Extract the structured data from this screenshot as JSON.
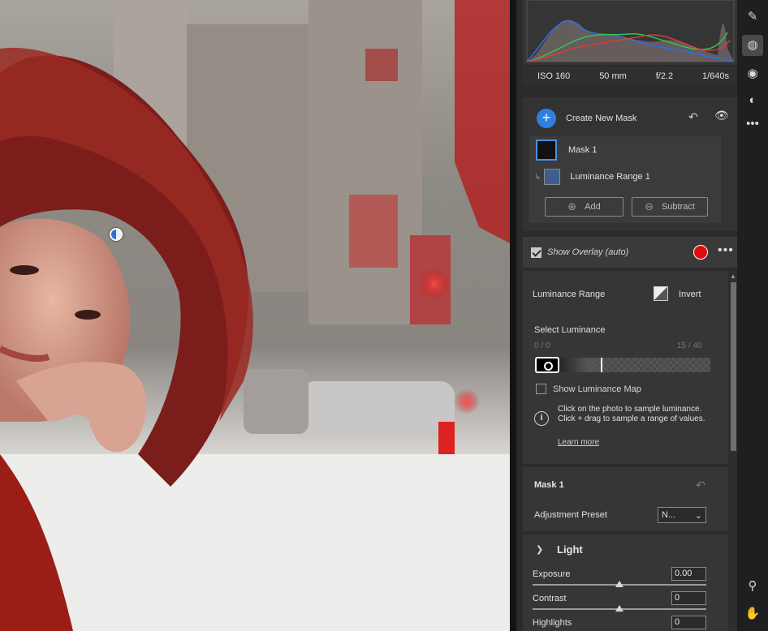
{
  "exif": {
    "iso": "ISO 160",
    "focal_length": "50 mm",
    "aperture": "f/2.2",
    "shutter": "1/640s"
  },
  "masks": {
    "create_label": "Create New Mask",
    "items": [
      {
        "label": "Mask 1"
      },
      {
        "label": "Luminance Range 1"
      }
    ],
    "add_label": "Add",
    "subtract_label": "Subtract"
  },
  "overlay": {
    "label": "Show Overlay (auto)",
    "checked": true,
    "color": "#e00c0c"
  },
  "luminance": {
    "title": "Luminance Range",
    "invert_label": "Invert",
    "select_label": "Select Luminance",
    "range_left": "0 / 0",
    "range_right": "15 / 40",
    "show_map_label": "Show Luminance Map",
    "info_text": "Click on the photo to sample luminance. Click + drag to sample a range of values.",
    "learn_more": "Learn more"
  },
  "mask_panel": {
    "title": "Mask 1",
    "preset_label": "Adjustment Preset",
    "preset_value": "N..."
  },
  "light": {
    "title": "Light",
    "adjustments": [
      {
        "label": "Exposure",
        "value": "0.00"
      },
      {
        "label": "Contrast",
        "value": "0"
      },
      {
        "label": "Highlights",
        "value": "0"
      }
    ]
  },
  "colors": {
    "accent": "#2f7fe0",
    "mask_overlay": "#e00c0c"
  },
  "icons": {
    "toolbar": [
      "healing-icon",
      "masking-icon",
      "red-eye-icon",
      "presets-icon",
      "more-icon",
      "zoom-icon",
      "hand-icon"
    ]
  }
}
